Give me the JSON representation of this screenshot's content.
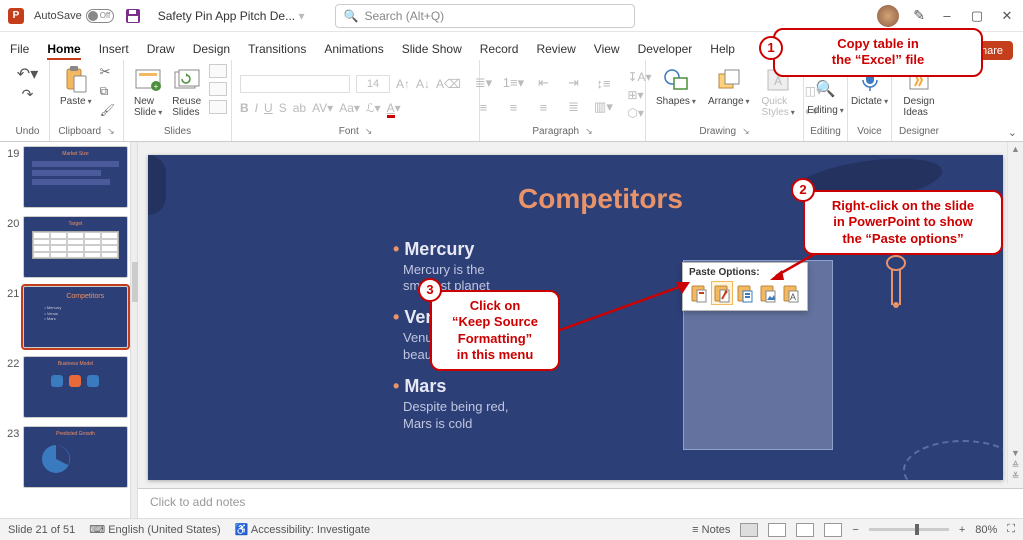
{
  "title": {
    "autosave": "AutoSave",
    "toggle_state": "Off",
    "filename": "Safety Pin App Pitch De...",
    "search_placeholder": "Search (Alt+Q)"
  },
  "window": {
    "minimize": "–",
    "maximize": "▢",
    "close": "✕",
    "pen_icon": "✎"
  },
  "menu": {
    "tabs": [
      "File",
      "Home",
      "Insert",
      "Draw",
      "Design",
      "Transitions",
      "Animations",
      "Slide Show",
      "Record",
      "Review",
      "View",
      "Developer",
      "Help"
    ],
    "record_btn": "Record",
    "share_btn": "Share"
  },
  "ribbon": {
    "undo_group": "Undo",
    "clipboard": {
      "paste": "Paste",
      "label": "Clipboard"
    },
    "slides": {
      "new_slide": "New\nSlide",
      "reuse": "Reuse\nSlides",
      "label": "Slides"
    },
    "font": {
      "placeholder": "",
      "size": "14",
      "label": "Font",
      "btns1": [
        "B",
        "I",
        "U",
        "S",
        "ab",
        "AV",
        "Aa",
        "A"
      ],
      "grow": "A",
      "shrink": "A",
      "clear": "Aᵩ"
    },
    "paragraph": {
      "label": "Paragraph"
    },
    "drawing": {
      "shapes": "Shapes",
      "arrange": "Arrange",
      "quick": "Quick\nStyles",
      "label": "Drawing"
    },
    "editing": {
      "label": "Editing",
      "btn": "Editing"
    },
    "voice": {
      "dictate": "Dictate",
      "label": "Voice"
    },
    "designer": {
      "design": "Design\nIdeas",
      "label": "Designer"
    }
  },
  "thumbs": {
    "items": [
      {
        "n": "19",
        "label": "Market Size"
      },
      {
        "n": "20",
        "label": "Target"
      },
      {
        "n": "21",
        "label": "Competitors"
      },
      {
        "n": "22",
        "label": "Business Model"
      },
      {
        "n": "23",
        "label": "Predicted Growth"
      }
    ]
  },
  "slide": {
    "title": "Competitors",
    "bullets": [
      {
        "head": "Mercury",
        "sub": "Mercury is the\nsmallest planet"
      },
      {
        "head": "Venus",
        "sub": "Venus has a\nbeautiful name"
      },
      {
        "head": "Mars",
        "sub": "Despite being red,\nMars is cold"
      }
    ],
    "paste_popup": {
      "title": "Paste Options:"
    }
  },
  "callouts": {
    "c1": "Copy table in\nthe “Excel” file",
    "c2": "Right-click on the slide\nin PowerPoint to show\nthe “Paste options”",
    "c3": "Click on\n“Keep Source\nFormatting”\nin this menu"
  },
  "notes_placeholder": "Click to add notes",
  "status": {
    "slide": "Slide 21 of 51",
    "lang": "English (United States)",
    "access": "Accessibility: Investigate",
    "notes": "Notes",
    "zoom": "80%"
  }
}
